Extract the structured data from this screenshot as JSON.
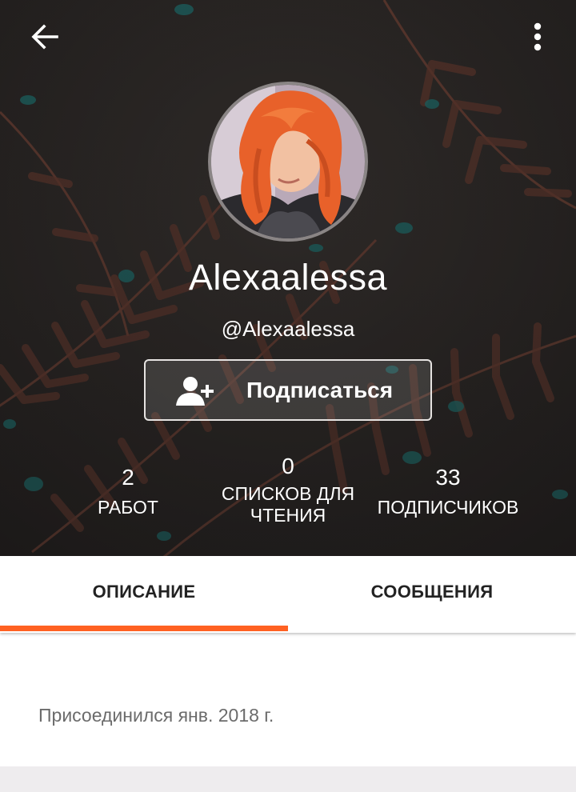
{
  "header": {
    "back_icon": "arrow-left-icon",
    "more_icon": "more-vertical-icon",
    "accent_bg": "#2a2624"
  },
  "profile": {
    "display_name": "Alexaalessa",
    "username": "@Alexaalessa",
    "avatar_icon": "user-avatar-photo"
  },
  "follow_button": {
    "label": "Подписаться",
    "icon": "add-user-icon"
  },
  "stats": {
    "works": {
      "value": "2",
      "label": "РАБОТ"
    },
    "reading_lists": {
      "value": "0",
      "label_line1": "СПИСКОВ ДЛЯ",
      "label_line2": "ЧТЕНИЯ"
    },
    "followers": {
      "value": "33",
      "label": "ПОДПИСЧИКОВ"
    }
  },
  "tabs": [
    {
      "label": "ОПИСАНИЕ",
      "active": true
    },
    {
      "label": "СООБЩЕНИЯ",
      "active": false
    }
  ],
  "about": {
    "joined": "Присоединился янв. 2018 г."
  },
  "colors": {
    "accent": "#ff6122",
    "text_muted": "#6b6b6b",
    "footer_band": "#eeecee"
  }
}
